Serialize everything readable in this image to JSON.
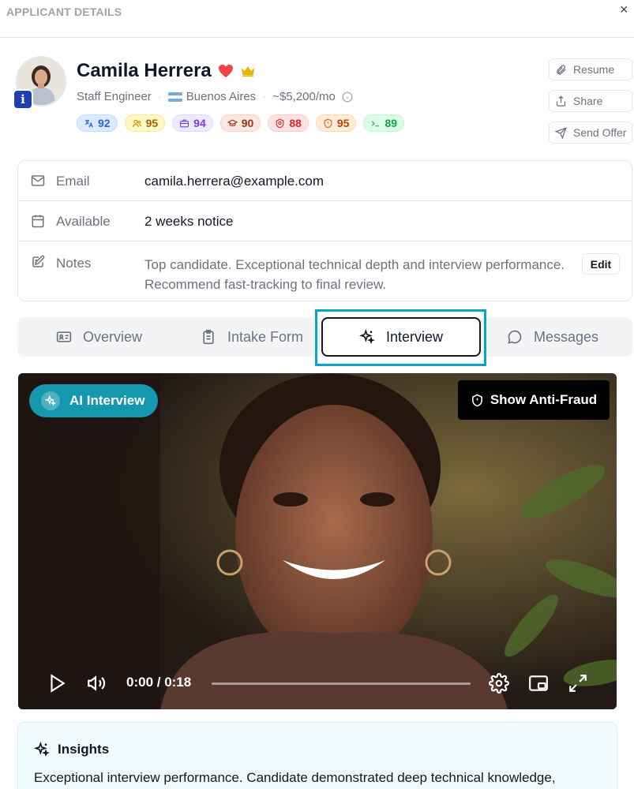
{
  "header": {
    "title": "APPLICANT DETAILS",
    "close_glyph": "×"
  },
  "profile": {
    "name": "Camila Herrera",
    "role": "Staff Engineer",
    "location": "Buenos Aires",
    "salary": "~$5,200/mo",
    "badge_letter": "i",
    "scores": [
      {
        "icon": "language-icon",
        "value": "92"
      },
      {
        "icon": "users-icon",
        "value": "95"
      },
      {
        "icon": "briefcase-icon",
        "value": "94"
      },
      {
        "icon": "graduation-cap-icon",
        "value": "90"
      },
      {
        "icon": "shield-badge-icon",
        "value": "88"
      },
      {
        "icon": "shield-alert-icon",
        "value": "95"
      },
      {
        "icon": "terminal-icon",
        "value": "89"
      }
    ]
  },
  "actions": {
    "resume": "Resume",
    "share": "Share",
    "send_offer": "Send Offer"
  },
  "details": {
    "email_label": "Email",
    "email_value": "camila.herrera@example.com",
    "available_label": "Available",
    "available_value": "2 weeks notice",
    "notes_label": "Notes",
    "notes_value": "Top candidate. Exceptional technical depth and interview performance. Recommend fast-tracking to final review.",
    "edit_label": "Edit"
  },
  "tabs": {
    "overview": "Overview",
    "intake": "Intake Form",
    "interview": "Interview",
    "messages": "Messages",
    "active": "interview"
  },
  "video": {
    "ai_label": "AI Interview",
    "fraud_label": "Show Anti-Fraud",
    "time": "0:00 / 0:18",
    "progress": 0.0
  },
  "insights": {
    "title": "Insights",
    "text": "Exceptional interview performance. Candidate demonstrated deep technical knowledge,"
  },
  "colors": {
    "accent": "#0aa4c8",
    "ai_chip": "#1597ad",
    "heart": "#ef4444",
    "crown": "#eab308"
  }
}
